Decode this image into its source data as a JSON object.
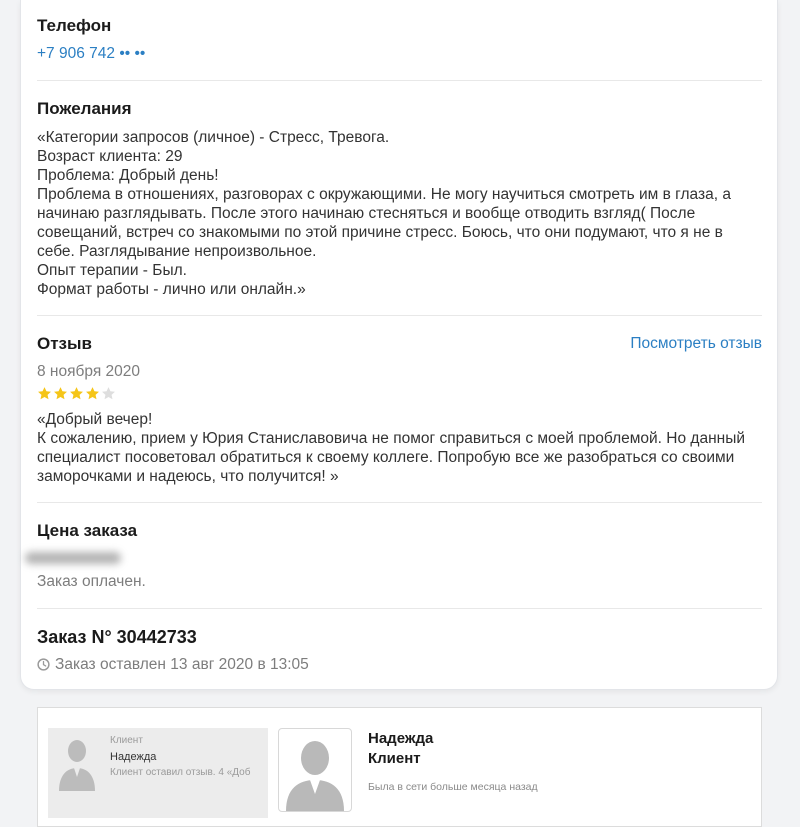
{
  "phone": {
    "label": "Телефон",
    "value": "+7 906 742 •• ••"
  },
  "wishes": {
    "label": "Пожелания",
    "lines": [
      "«Категории запросов (личное) - Стресс, Тревога.",
      "Возраст клиента: 29",
      "Проблема: Добрый день!",
      "Проблема в отношениях, разговорах с окружающими. Не могу научиться смотреть им в глаза, а",
      "начинаю разглядывать. После этого начинаю стесняться и вообще отводить взгляд( После",
      "совещаний, встреч со знакомыми по этой причине стресс. Боюсь, что они подумают, что я не в",
      "себе. Разглядывание непроизвольное.",
      "Опыт терапии - Был.",
      "Формат работы - лично или онлайн.»"
    ]
  },
  "review": {
    "label": "Отзыв",
    "view_link": "Посмотреть отзыв",
    "date": "8 ноября 2020",
    "rating": 4,
    "rating_max": 5,
    "lines": [
      "«Добрый вечер!",
      "К сожалению, прием у Юрия Станиславовича не помог справиться с моей проблемой. Но данный",
      "специалист посоветовал обратиться к своему коллеге. Попробую все же разобраться со своими",
      "заморочками и надеюсь, что получится! »"
    ]
  },
  "price": {
    "label": "Цена заказа",
    "status": "Заказ оплачен."
  },
  "order": {
    "title": "Заказ N° 30442733",
    "created": "Заказ оставлен 13 авг 2020 в 13:05"
  },
  "client_card": {
    "preview": {
      "role": "Клиент",
      "name": "Надежда",
      "snippet": "Клиент оставил отзыв. 4 «Доб"
    },
    "name": "Надежда",
    "role": "Клиент",
    "last_seen": "Была в сети больше месяца назад"
  },
  "icons": {
    "created": "clock-icon",
    "rating": "star-icon",
    "avatar": "person-silhouette-icon"
  },
  "colors": {
    "link": "#2b7fc3",
    "star_filled": "#f5c518",
    "star_empty": "#dedede"
  }
}
